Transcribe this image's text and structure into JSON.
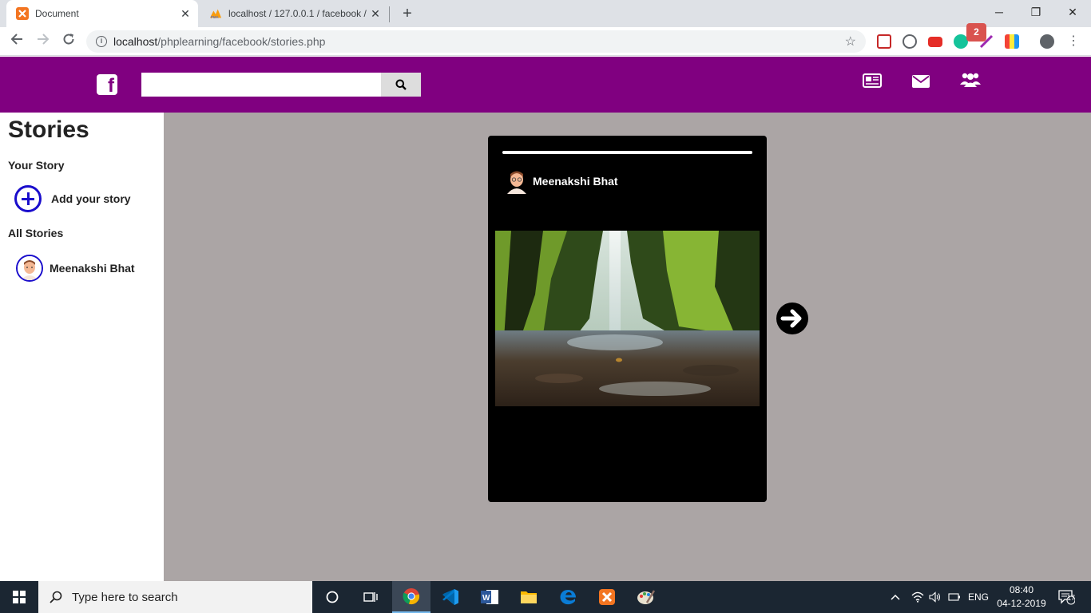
{
  "browser": {
    "tabs": [
      {
        "title": "Document",
        "close": "✕"
      },
      {
        "title": "localhost / 127.0.0.1 / facebook /",
        "close": "✕"
      }
    ],
    "new_tab": "+",
    "window_controls": {
      "minimize": "─",
      "maximize": "❐",
      "close": "✕"
    },
    "url_host": "localhost",
    "url_path": "/phplearning/facebook/stories.php"
  },
  "header": {
    "logo": "f",
    "search": {
      "value": "",
      "placeholder": ""
    },
    "friends_badge": "2",
    "brand_color": "#800080"
  },
  "sidebar": {
    "title": "Stories",
    "your_story_label": "Your Story",
    "add_story_label": "Add your story",
    "all_stories_label": "All Stories",
    "stories": [
      {
        "name": "Meenakshi Bhat"
      }
    ]
  },
  "story": {
    "user_name": "Meenakshi Bhat",
    "progress_fraction": 1.0,
    "image_subject": "waterfall in mossy canyon"
  },
  "taskbar": {
    "search_placeholder": "Type here to search",
    "language": "ENG",
    "time": "08:40",
    "date": "04-12-2019",
    "notification_count": "17"
  }
}
